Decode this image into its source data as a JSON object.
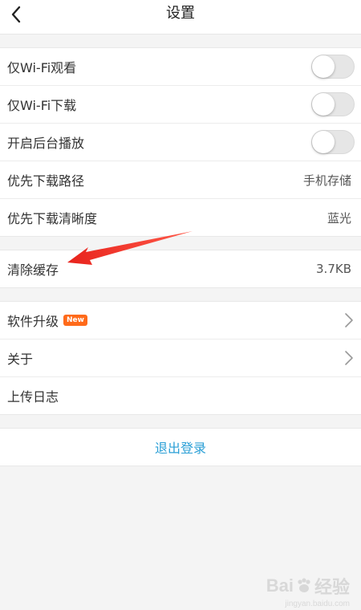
{
  "header": {
    "title": "设置"
  },
  "group1": {
    "items": [
      {
        "label": "仅Wi-Fi观看",
        "toggle_on": false
      },
      {
        "label": "仅Wi-Fi下载",
        "toggle_on": false
      },
      {
        "label": "开启后台播放",
        "toggle_on": false
      },
      {
        "label": "优先下载路径",
        "value": "手机存储"
      },
      {
        "label": "优先下载清晰度",
        "value": "蓝光"
      }
    ]
  },
  "group2": {
    "items": [
      {
        "label": "清除缓存",
        "value": "3.7KB"
      }
    ]
  },
  "group3": {
    "items": [
      {
        "label": "软件升级",
        "badge": "New"
      },
      {
        "label": "关于"
      },
      {
        "label": "上传日志"
      }
    ]
  },
  "logout": {
    "label": "退出登录"
  },
  "colors": {
    "accent": "#2a9fd6",
    "badge": "#ff6a1a",
    "annotation_arrow": "#e8231c"
  },
  "watermark": {
    "text": "Bai",
    "text_after": "经验",
    "sub": "jingyan.baidu.com"
  }
}
